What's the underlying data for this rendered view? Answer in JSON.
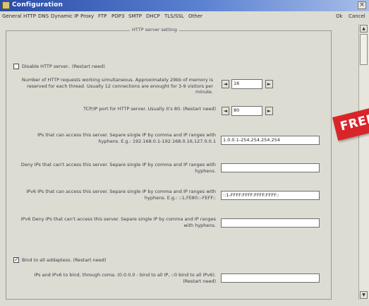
{
  "window": {
    "title": "Configuration",
    "close_glyph": "×"
  },
  "tabs": [
    "General",
    "HTTP",
    "DNS",
    "Dynamic IP",
    "Proxy",
    "FTP",
    "POP3",
    "SMTP",
    "DHCP",
    "TLS/SSL",
    "Other"
  ],
  "buttons": {
    "ok": "Ok",
    "cancel": "Cancel"
  },
  "group": {
    "legend": "HTTP server setting"
  },
  "settings": {
    "disable_http": {
      "label": "Disable HTTP server.. (Restart need)",
      "checked": false
    },
    "threads": {
      "label": "Number of HTTP requests working simultaneous. Approximately 29kb of memory is reserved for each thread. Usually 12 connections are enought for 3-9 visitors per minute.",
      "value": "16"
    },
    "port": {
      "label": "TCP/IP port for HTTP server. Usually it's 80. (Restart need)",
      "value": "80"
    },
    "allowed_ips": {
      "label": "IPs that can access this server. Separe single IP by comma and IP ranges with hyphens. E.g.: 192.168.0.1-192.168.0.16,127.0.0.1",
      "value": "1.0.0.1-254.254.254.254"
    },
    "deny_ips": {
      "label": "Deny IPs that can't access this server. Separe single IP by comma and IP ranges with hyphens.",
      "value": ""
    },
    "ipv6_allowed": {
      "label": "IPv6 IPs that can access this server. Separe single IP by comma and IP ranges with hyphens. E.g.: ::1,FE80::-FEFF::",
      "value": "::1-FFFF:FFFF:FFFF:FFFF::"
    },
    "ipv6_deny": {
      "label": "IPv6 Deny IPs that can't access this server. Separe single IP by comma and IP ranges with hyphens.",
      "value": ""
    },
    "bind_all": {
      "label": "Bind to all addaptess. (Restart need)",
      "checked": true
    },
    "bind_ips": {
      "label": "IPs and IPv6 to bind, through coma. (0.0.0.0 - bind to all IP, ::0 bind to all IPv6). (Restart need)",
      "value": ""
    }
  },
  "spinner": {
    "left_glyph": "◄",
    "right_glyph": "►"
  },
  "scrollbar": {
    "up_glyph": "▲",
    "down_glyph": "▼"
  },
  "badge": {
    "text": "FREE"
  },
  "icons": {
    "window_icon": "config-icon",
    "checkmark": "✓"
  },
  "colors": {
    "titlebar": "#2a4da6",
    "window_bg": "#dcdcd2",
    "badge": "#d9252a"
  }
}
